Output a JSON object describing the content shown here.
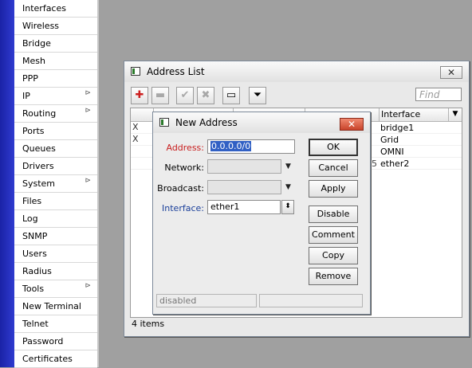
{
  "menu": {
    "items": [
      {
        "label": "Interfaces",
        "submenu": false
      },
      {
        "label": "Wireless",
        "submenu": false
      },
      {
        "label": "Bridge",
        "submenu": false
      },
      {
        "label": "Mesh",
        "submenu": false
      },
      {
        "label": "PPP",
        "submenu": false
      },
      {
        "label": "IP",
        "submenu": true
      },
      {
        "label": "Routing",
        "submenu": true
      },
      {
        "label": "Ports",
        "submenu": false
      },
      {
        "label": "Queues",
        "submenu": false
      },
      {
        "label": "Drivers",
        "submenu": false
      },
      {
        "label": "System",
        "submenu": true
      },
      {
        "label": "Files",
        "submenu": false
      },
      {
        "label": "Log",
        "submenu": false
      },
      {
        "label": "SNMP",
        "submenu": false
      },
      {
        "label": "Users",
        "submenu": false
      },
      {
        "label": "Radius",
        "submenu": false
      },
      {
        "label": "Tools",
        "submenu": true
      },
      {
        "label": "New Terminal",
        "submenu": false
      },
      {
        "label": "Telnet",
        "submenu": false
      },
      {
        "label": "Password",
        "submenu": false
      },
      {
        "label": "Certificates",
        "submenu": false
      }
    ],
    "submenu_glyph": "⊳"
  },
  "address_list": {
    "title": "Address List",
    "close_glyph": "✕",
    "toolbar": {
      "add_glyph": "✚",
      "remove_glyph": "▬",
      "enable_glyph": "✔",
      "disable_glyph": "✖",
      "comment_glyph": "▭",
      "filter_glyph": "⏷"
    },
    "find_placeholder": "Find",
    "column_interface": "Interface",
    "column_dropdown_glyph": "▼",
    "rows": [
      {
        "flag": "X",
        "interface": "bridge1"
      },
      {
        "flag": "X",
        "interface": "Grid"
      },
      {
        "flag": "",
        "interface": "OMNI"
      },
      {
        "flag": "",
        "interface": "ether2"
      }
    ],
    "row_fragment": "5",
    "items_count": "4 items"
  },
  "new_address": {
    "title": "New Address",
    "close_glyph": "✕",
    "address_label": "Address:",
    "address_value": "0.0.0.0/0",
    "network_label": "Network:",
    "network_value": "",
    "broadcast_label": "Broadcast:",
    "broadcast_value": "",
    "interface_label": "Interface:",
    "interface_value": "ether1",
    "arrow_glyph": "▼",
    "updown_glyph": "⬍",
    "buttons": {
      "ok": "OK",
      "cancel": "Cancel",
      "apply": "Apply",
      "disable": "Disable",
      "comment": "Comment",
      "copy": "Copy",
      "remove": "Remove"
    },
    "status": "disabled"
  },
  "colors": {
    "accent_blue": "#2f3bd0",
    "required_label": "#c81e1e",
    "interface_label": "#1a3f9a",
    "close_red": "#c8432b",
    "add_red": "#cc1f1f"
  }
}
